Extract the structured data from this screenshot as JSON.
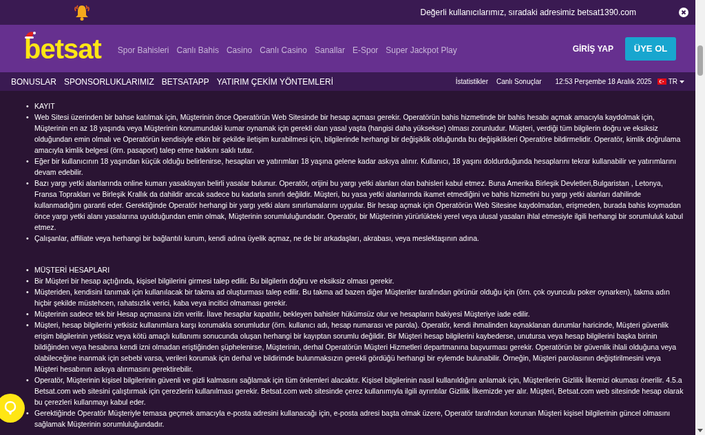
{
  "notice": {
    "text": "Değerli kullanıcılarımız, sıradaki adresimiz betsat1390.com"
  },
  "header": {
    "logo": "betsat",
    "nav": [
      "Spor Bahisleri",
      "Canlı Bahis",
      "Casino",
      "Canlı Casino",
      "Sanallar",
      "E-Spor",
      "Super Jackpot Play"
    ],
    "login": "GİRİŞ YAP",
    "register": "ÜYE OL"
  },
  "subnav": {
    "links": [
      "BONUSLAR",
      "SPONSORLUKLARIMIZ",
      "BETSATAPP",
      "YATIRIM ÇEKİM YÖNTEMLERİ"
    ],
    "right_links": [
      "İstatistikler",
      "Canlı Sonuçlar"
    ],
    "datetime": "12:53 Perşembe 18 Aralık 2025",
    "language": "TR"
  },
  "sections": [
    {
      "items": [
        {
          "bullet": "•",
          "text": "KAYIT"
        },
        {
          "bullet": "•",
          "text": "Web Sitesi üzerinden bir bahse katılmak için, Müşterinin önce Operatörün Web Sitesinde bir hesap açması gerekir. Operatörün bahis hizmetinde bir bahis hesabı açmak amacıyla kaydolmak için, Müşterinin en az 18 yaşında veya Müşterinin konumundaki kumar oynamak için gerekli olan yasal yaşta (hangisi daha yüksekse) olması zorunludur. Müşteri, verdiği tüm bilgilerin doğru ve eksiksiz olduğundan emin olmalı ve Operatörün kendisiyle etkin bir şekilde iletişim kurabilmesi için, bilgilerinde herhangi bir değişiklik olduğunda bu değişiklikleri Operatöre bildirmelidir. Operatör, kimlik doğrulama amacıyla kimlik belgesi (örn. pasaport) talep etme hakkını saklı tutar."
        },
        {
          "bullet": "•",
          "text": "Eğer bir kullanıcının 18 yaşından küçük olduğu belirlenirse, hesapları ve yatırımları 18 yaşına gelene kadar askıya alınır. Kullanıcı, 18 yaşını doldurduğunda hesaplarını tekrar kullanabilir ve yatırımlarını devam edebilir."
        },
        {
          "bullet": "•",
          "text": "Bazı yargı yetki alanlarında online kumarı yasaklayan belirli yasalar bulunur. Operatör, orijini bu yargı yetki alanları olan bahisleri kabul etmez. Buna Amerika Birleşik Devletleri,Bulgaristan , Letonya, Fransa Toprakları ve Birleşik Krallık da dahildir ancak sadece bu kadarla sınırlı değildir. Müşteri, bu yasa yetki alanlarında ikamet etmediğini ve bahis hizmetini bu yargı yetki alanları dahilinde kullanmadığını garanti eder. Gerektiğinde Operatör herhangi bir yargı yetki alanı sınırlamalarını uygular. Bir hesap açmak için Operatörün Web Sitesine kaydolmadan, erişmeden, burada bahis koymadan önce yargı yetki alanı yasalarına uyulduğundan emin olmak, Müşterinin sorumluluğundadır. Operatör, bir Müşterinin yürürlükteki yerel veya ulusal yasaları ihlal etmesiyle ilgili herhangi bir sorumluluk kabul etmez."
        },
        {
          "bullet": "•",
          "text": "Çalışanlar, affiliate veya herhangi bir bağlantılı kurum, kendi adına üyelik açmaz, ne de bir arkadaşları, akrabası, veya meslektaşının adına."
        }
      ]
    },
    {
      "items": [
        {
          "bullet": "•",
          "text": "MÜŞTERİ HESAPLARI"
        },
        {
          "bullet": "•",
          "text": "Bir Müşteri bir hesap açtığında, kişisel bilgilerini girmesi talep edilir. Bu bilgilerin doğru ve eksiksiz olması gerekir."
        },
        {
          "bullet": "•",
          "text": "Müşteriden, kendisini tanımak için kullanılacak bir takma ad oluşturması talep edilir. Bu takma ad bazen diğer Müşteriler tarafından görünür olduğu için (örn. çok oyunculu poker oynarken), takma adın hiçbir şekilde müstehcen, rahatsızlık verici, kaba veya incitici olmaması gerekir."
        },
        {
          "bullet": "•",
          "text": "Müşterinin sadece tek bir Hesap açmasına izin verilir. İlave hesaplar kapatılır, bekleyen bahisler hükümsüz olur ve hesapların bakiyesi Müşteriye iade edilir."
        },
        {
          "bullet": "•",
          "text": "Müşteri, hesap bilgilerini yetkisiz kullanımlara karşı korumakla sorumludur (örn. kullanıcı adı, hesap numarası ve parola). Operatör, kendi ihmalinden kaynaklanan durumlar haricinde, Müşteri güvenlik erişim bilgilerinin yetkisiz veya kötü amaçlı kullanımı sonucunda oluşan herhangi bir kayıptan sorumlu değildir. Bir Müşteri hesap bilgilerini kaybederse, unutursa veya hesap bilgilerini başka birinin bildiğinden veya hesabına kendi izni olmadan eriştiğinden şüphelenirse, Müşterinin, derhal Operatörün Müşteri Hizmetleri departmanına başvurması gerekir. Operatörün bir güvenlik ihlali olduğuna veya olabileceğine inanmak için sebebi varsa, verileri korumak için derhal ve bildirimde bulunmaksızın gerekli gördüğü herhangi bir eylemde bulunabilir. Örneğin, Müşteri parolasının değiştirilmesini veya Müşteri hesabının askıya alınmasını gerektirebilir."
        },
        {
          "bullet": "•",
          "text": "Operatör, Müşterinin kişisel bilgilerinin güvenli ve gizli kalmasını sağlamak için tüm önlemleri alacaktır. Kişisel bilgilerinin nasıl kullanıldığını anlamak için, Müşterilerin Gizlilik İlkemizi okuması önerilir. 4.5.a Betsat.com web sitesini çalıştırmak için çerezlerin kullanılması gerekir. Betsat.com web sitesinde çerez kullanımıyla ilgili ayrıntılar Gizlilik İlkemizde yer alır. Müşteri, Betsat.com web sitesinde hesap olarak bu çerezleri kullanmayı kabul eder."
        },
        {
          "bullet": "•",
          "text": "Gerektiğinde Operatör Müşteriyle temasa geçmek amacıyla e-posta adresini kullanacağı için, e-posta adresi başta olmak üzere, Operatör tarafından korunan Müşteri kişisel bilgilerinin güncel olmasını sağlamak Müşterinin sorumluluğundadır."
        }
      ]
    }
  ]
}
